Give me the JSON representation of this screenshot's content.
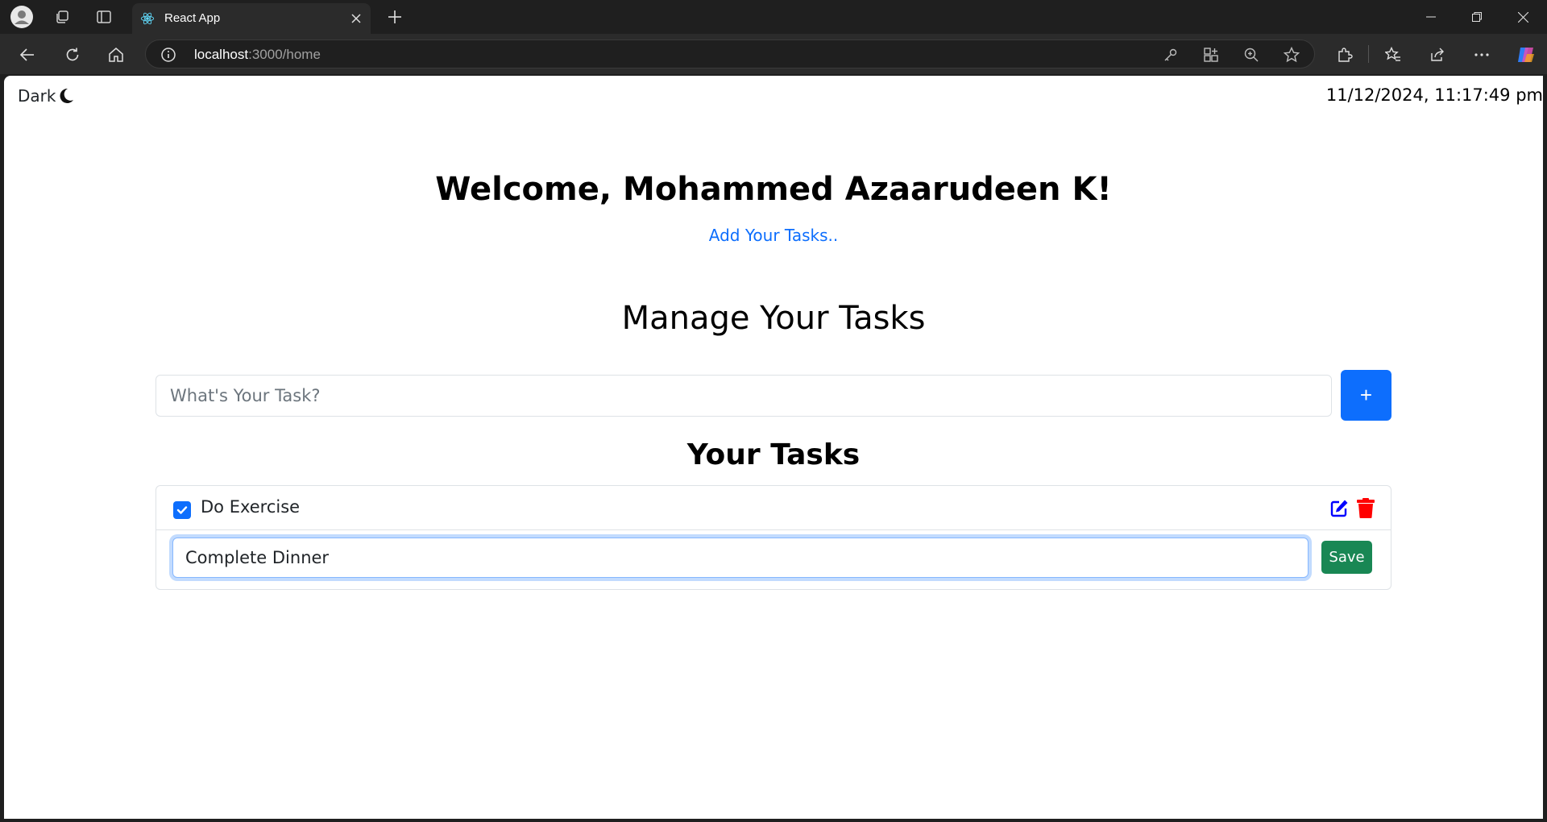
{
  "browser": {
    "tab_title": "React App",
    "url_host": "localhost",
    "url_rest": ":3000/home"
  },
  "page": {
    "theme_toggle_label": "Dark",
    "datetime": "11/12/2024, 11:17:49 pm",
    "welcome": "Welcome, Mohammed Azaarudeen K!",
    "subtitle_link": "Add Your Tasks..",
    "manage_title": "Manage Your Tasks",
    "task_input_placeholder": "What's Your Task?",
    "add_button_label": "+",
    "tasks_title": "Your Tasks",
    "tasks": [
      {
        "text": "Do Exercise",
        "done": true
      }
    ],
    "editing_value": "Complete Dinner",
    "save_label": "Save"
  },
  "colors": {
    "primary": "#0d6efd",
    "success": "#198754",
    "edit_icon": "#0000ff",
    "delete_icon": "#ff0000"
  }
}
